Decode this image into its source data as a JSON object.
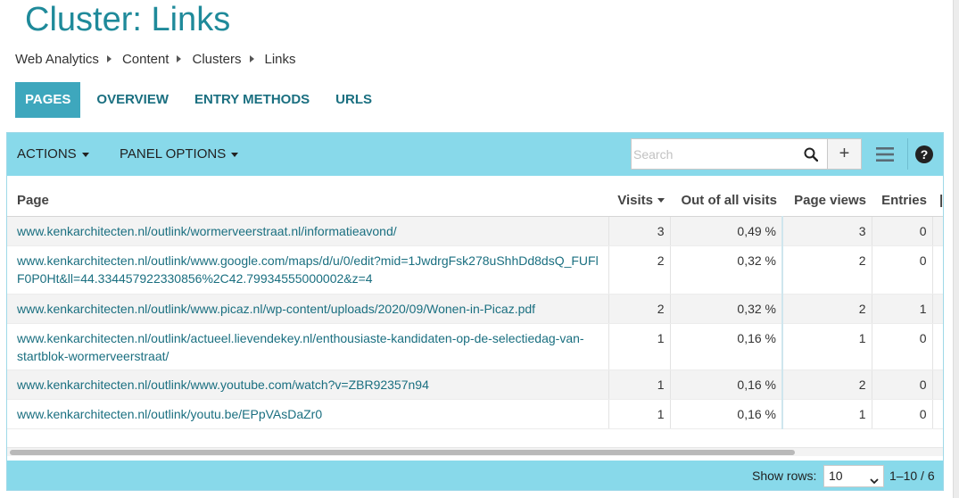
{
  "page": {
    "title": "Cluster: Links"
  },
  "breadcrumb": [
    "Web Analytics",
    "Content",
    "Clusters",
    "Links"
  ],
  "tabs": [
    {
      "label": "PAGES",
      "active": true
    },
    {
      "label": "OVERVIEW",
      "active": false
    },
    {
      "label": "ENTRY METHODS",
      "active": false
    },
    {
      "label": "URLS",
      "active": false
    }
  ],
  "toolbar": {
    "actions_label": "ACTIONS",
    "panel_options_label": "PANEL OPTIONS",
    "search_placeholder": "Search",
    "search_value": "",
    "plus_label": "+",
    "icons": [
      "search-icon",
      "plus-icon",
      "list-icon",
      "help-icon"
    ]
  },
  "table": {
    "columns": [
      "Page",
      "Visits",
      "Out of all visits",
      "Page views",
      "Entries"
    ],
    "sorted_by": "Visits",
    "rows": [
      {
        "page": "www.kenkarchitecten.nl/outlink/wormerveerstraat.nl/informatieavond/",
        "visits": "3",
        "share": "0,49 %",
        "page_views": "3",
        "entries": "0"
      },
      {
        "page": "www.kenkarchitecten.nl/outlink/www.google.com/maps/d/u/0/edit?mid=1JwdrgFsk278uShhDd8dsQ_FUFlF0P0Ht&ll=44.334457922330856%2C42.79934555000002&z=4",
        "visits": "2",
        "share": "0,32 %",
        "page_views": "2",
        "entries": "0"
      },
      {
        "page": "www.kenkarchitecten.nl/outlink/www.picaz.nl/wp-content/uploads/2020/09/Wonen-in-Picaz.pdf",
        "visits": "2",
        "share": "0,32 %",
        "page_views": "2",
        "entries": "1"
      },
      {
        "page": "www.kenkarchitecten.nl/outlink/actueel.lievendekey.nl/enthousiaste-kandidaten-op-de-selectiedag-van-startblok-wormerveerstraat/",
        "visits": "1",
        "share": "0,16 %",
        "page_views": "1",
        "entries": "0"
      },
      {
        "page": "www.kenkarchitecten.nl/outlink/www.youtube.com/watch?v=ZBR92357n94",
        "visits": "1",
        "share": "0,16 %",
        "page_views": "2",
        "entries": "0"
      },
      {
        "page": "www.kenkarchitecten.nl/outlink/youtu.be/EPpVAsDaZr0",
        "visits": "1",
        "share": "0,16 %",
        "page_views": "1",
        "entries": "0"
      }
    ]
  },
  "footer": {
    "show_rows_label": "Show rows:",
    "rows_per_page": "10",
    "range": "1–10 / 6"
  },
  "colors": {
    "title": "#1f8a9a",
    "accent": "#3ea7bd",
    "toolbar_bg": "#88d9ea",
    "link": "#1a6f80"
  }
}
